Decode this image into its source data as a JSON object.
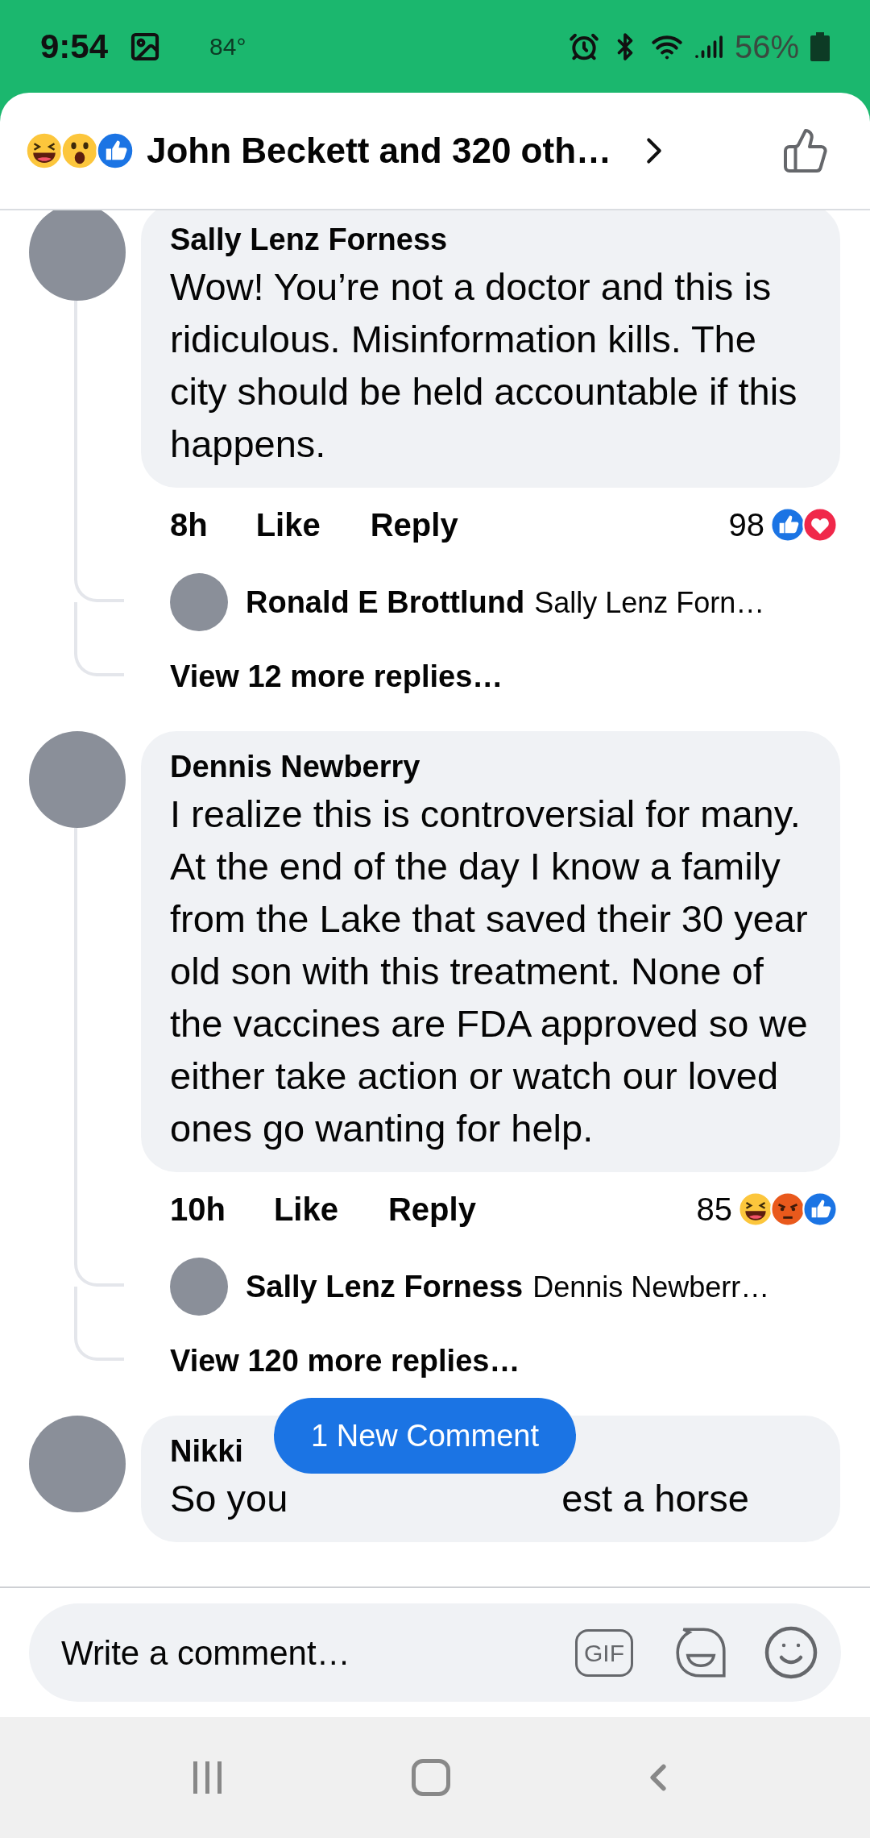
{
  "status_bar": {
    "time": "9:54",
    "temperature": "84°",
    "battery": "56%"
  },
  "header": {
    "reactions": [
      {
        "kind": "haha"
      },
      {
        "kind": "wow"
      },
      {
        "kind": "like"
      }
    ],
    "title": "John Beckett and 320 oth…"
  },
  "comments": [
    {
      "author": "Sally Lenz Forness",
      "text": "Wow! You’re not a doctor and this is ridiculous. Misinformation kills. The city should be held accountable if this happens.",
      "time": "8h",
      "like": "Like",
      "reply": "Reply",
      "reaction_count": "98",
      "reactions": [
        {
          "kind": "like"
        },
        {
          "kind": "love"
        }
      ],
      "replies": [
        {
          "author": "Ronald E Brottlund",
          "text": "Sally Lenz Forn…"
        }
      ],
      "more_replies": "View 12 more replies…"
    },
    {
      "author": "Dennis Newberry",
      "text": "I realize this is controversial for many. At the end of the day I know a family from the Lake that saved their 30 year old son with this treatment. None of the vaccines are FDA approved so we either take action or watch our loved ones go wanting for help.",
      "time": "10h",
      "like": "Like",
      "reply": "Reply",
      "reaction_count": "85",
      "reactions": [
        {
          "kind": "haha"
        },
        {
          "kind": "angry"
        },
        {
          "kind": "like"
        }
      ],
      "replies": [
        {
          "author": "Sally Lenz Forness",
          "text": "Dennis Newberr…"
        }
      ],
      "more_replies": "View 120 more replies…"
    },
    {
      "author": "Nikki",
      "text_parts": [
        "So you",
        "est a horse"
      ]
    }
  ],
  "new_comment_pill": "1 New Comment",
  "composer": {
    "placeholder": "Write a comment…",
    "gif_label": "GIF"
  }
}
